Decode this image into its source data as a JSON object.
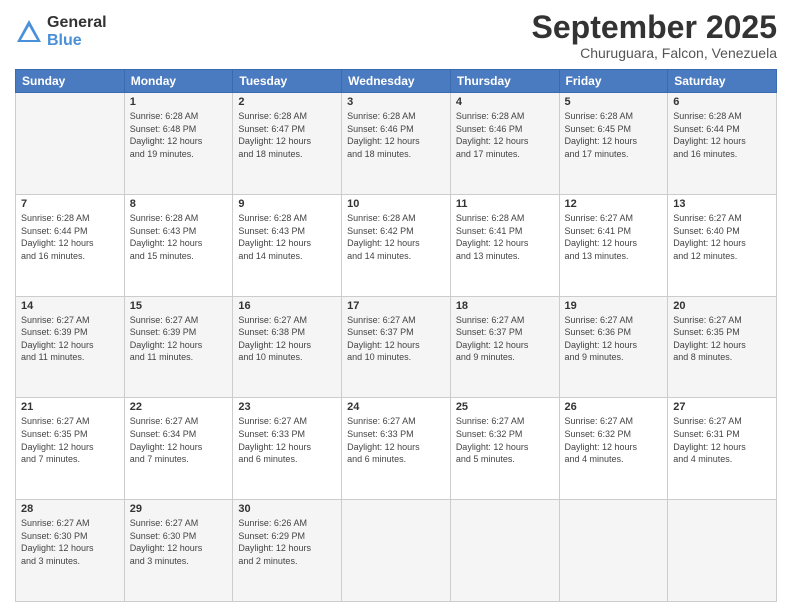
{
  "logo": {
    "general": "General",
    "blue": "Blue"
  },
  "title": "September 2025",
  "location": "Churuguara, Falcon, Venezuela",
  "weekdays": [
    "Sunday",
    "Monday",
    "Tuesday",
    "Wednesday",
    "Thursday",
    "Friday",
    "Saturday"
  ],
  "weeks": [
    [
      {
        "day": null,
        "info": null
      },
      {
        "day": "1",
        "info": "Sunrise: 6:28 AM\nSunset: 6:48 PM\nDaylight: 12 hours\nand 19 minutes."
      },
      {
        "day": "2",
        "info": "Sunrise: 6:28 AM\nSunset: 6:47 PM\nDaylight: 12 hours\nand 18 minutes."
      },
      {
        "day": "3",
        "info": "Sunrise: 6:28 AM\nSunset: 6:46 PM\nDaylight: 12 hours\nand 18 minutes."
      },
      {
        "day": "4",
        "info": "Sunrise: 6:28 AM\nSunset: 6:46 PM\nDaylight: 12 hours\nand 17 minutes."
      },
      {
        "day": "5",
        "info": "Sunrise: 6:28 AM\nSunset: 6:45 PM\nDaylight: 12 hours\nand 17 minutes."
      },
      {
        "day": "6",
        "info": "Sunrise: 6:28 AM\nSunset: 6:44 PM\nDaylight: 12 hours\nand 16 minutes."
      }
    ],
    [
      {
        "day": "7",
        "info": "Sunrise: 6:28 AM\nSunset: 6:44 PM\nDaylight: 12 hours\nand 16 minutes."
      },
      {
        "day": "8",
        "info": "Sunrise: 6:28 AM\nSunset: 6:43 PM\nDaylight: 12 hours\nand 15 minutes."
      },
      {
        "day": "9",
        "info": "Sunrise: 6:28 AM\nSunset: 6:43 PM\nDaylight: 12 hours\nand 14 minutes."
      },
      {
        "day": "10",
        "info": "Sunrise: 6:28 AM\nSunset: 6:42 PM\nDaylight: 12 hours\nand 14 minutes."
      },
      {
        "day": "11",
        "info": "Sunrise: 6:28 AM\nSunset: 6:41 PM\nDaylight: 12 hours\nand 13 minutes."
      },
      {
        "day": "12",
        "info": "Sunrise: 6:27 AM\nSunset: 6:41 PM\nDaylight: 12 hours\nand 13 minutes."
      },
      {
        "day": "13",
        "info": "Sunrise: 6:27 AM\nSunset: 6:40 PM\nDaylight: 12 hours\nand 12 minutes."
      }
    ],
    [
      {
        "day": "14",
        "info": "Sunrise: 6:27 AM\nSunset: 6:39 PM\nDaylight: 12 hours\nand 11 minutes."
      },
      {
        "day": "15",
        "info": "Sunrise: 6:27 AM\nSunset: 6:39 PM\nDaylight: 12 hours\nand 11 minutes."
      },
      {
        "day": "16",
        "info": "Sunrise: 6:27 AM\nSunset: 6:38 PM\nDaylight: 12 hours\nand 10 minutes."
      },
      {
        "day": "17",
        "info": "Sunrise: 6:27 AM\nSunset: 6:37 PM\nDaylight: 12 hours\nand 10 minutes."
      },
      {
        "day": "18",
        "info": "Sunrise: 6:27 AM\nSunset: 6:37 PM\nDaylight: 12 hours\nand 9 minutes."
      },
      {
        "day": "19",
        "info": "Sunrise: 6:27 AM\nSunset: 6:36 PM\nDaylight: 12 hours\nand 9 minutes."
      },
      {
        "day": "20",
        "info": "Sunrise: 6:27 AM\nSunset: 6:35 PM\nDaylight: 12 hours\nand 8 minutes."
      }
    ],
    [
      {
        "day": "21",
        "info": "Sunrise: 6:27 AM\nSunset: 6:35 PM\nDaylight: 12 hours\nand 7 minutes."
      },
      {
        "day": "22",
        "info": "Sunrise: 6:27 AM\nSunset: 6:34 PM\nDaylight: 12 hours\nand 7 minutes."
      },
      {
        "day": "23",
        "info": "Sunrise: 6:27 AM\nSunset: 6:33 PM\nDaylight: 12 hours\nand 6 minutes."
      },
      {
        "day": "24",
        "info": "Sunrise: 6:27 AM\nSunset: 6:33 PM\nDaylight: 12 hours\nand 6 minutes."
      },
      {
        "day": "25",
        "info": "Sunrise: 6:27 AM\nSunset: 6:32 PM\nDaylight: 12 hours\nand 5 minutes."
      },
      {
        "day": "26",
        "info": "Sunrise: 6:27 AM\nSunset: 6:32 PM\nDaylight: 12 hours\nand 4 minutes."
      },
      {
        "day": "27",
        "info": "Sunrise: 6:27 AM\nSunset: 6:31 PM\nDaylight: 12 hours\nand 4 minutes."
      }
    ],
    [
      {
        "day": "28",
        "info": "Sunrise: 6:27 AM\nSunset: 6:30 PM\nDaylight: 12 hours\nand 3 minutes."
      },
      {
        "day": "29",
        "info": "Sunrise: 6:27 AM\nSunset: 6:30 PM\nDaylight: 12 hours\nand 3 minutes."
      },
      {
        "day": "30",
        "info": "Sunrise: 6:26 AM\nSunset: 6:29 PM\nDaylight: 12 hours\nand 2 minutes."
      },
      {
        "day": null,
        "info": null
      },
      {
        "day": null,
        "info": null
      },
      {
        "day": null,
        "info": null
      },
      {
        "day": null,
        "info": null
      }
    ]
  ]
}
